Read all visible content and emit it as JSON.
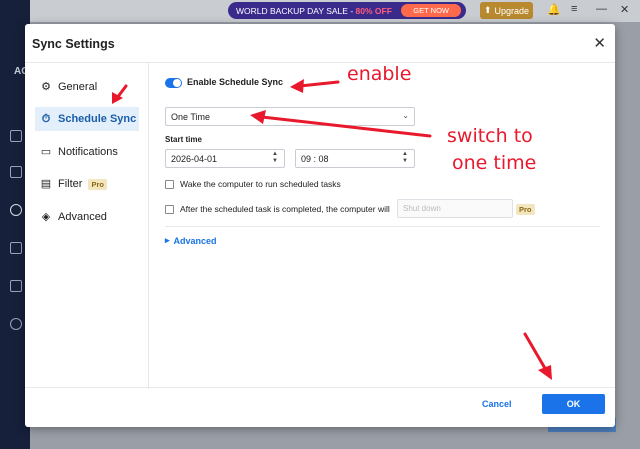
{
  "background": {
    "sale_banner": {
      "text": "WORLD BACKUP DAY SALE - ",
      "percent": "80% OFF",
      "cta": "GET NOW"
    },
    "upgrade": "Upgrade",
    "sidebar_text": "AC"
  },
  "dialog": {
    "title": "Sync Settings",
    "close_icon": "close-icon",
    "nav": [
      {
        "label": "General",
        "icon": "gear-icon"
      },
      {
        "label": "Schedule Sync",
        "icon": "clock-icon",
        "active": true
      },
      {
        "label": "Notifications",
        "icon": "notification-icon"
      },
      {
        "label": "Filter",
        "icon": "filter-icon",
        "badge": "Pro"
      },
      {
        "label": "Advanced",
        "icon": "advanced-icon"
      }
    ],
    "schedule": {
      "enable_label": "Enable Schedule Sync",
      "enabled": true,
      "frequency": "One Time",
      "start_time_label": "Start time",
      "date": "2026-04-01",
      "time": "09 : 08",
      "wake_label": "Wake the computer to run scheduled tasks",
      "after_label": "After the scheduled task is completed, the computer will",
      "after_value": "Shut down",
      "after_badge": "Pro",
      "advanced_link": "Advanced"
    },
    "footer": {
      "cancel": "Cancel",
      "ok": "OK"
    }
  },
  "annotations": {
    "enable": "enable",
    "switch_line1": "switch to",
    "switch_line2": "one time"
  },
  "colors": {
    "accent": "#1a73e8",
    "annotation": "#e8192c",
    "active_nav_bg": "#e4effc"
  }
}
